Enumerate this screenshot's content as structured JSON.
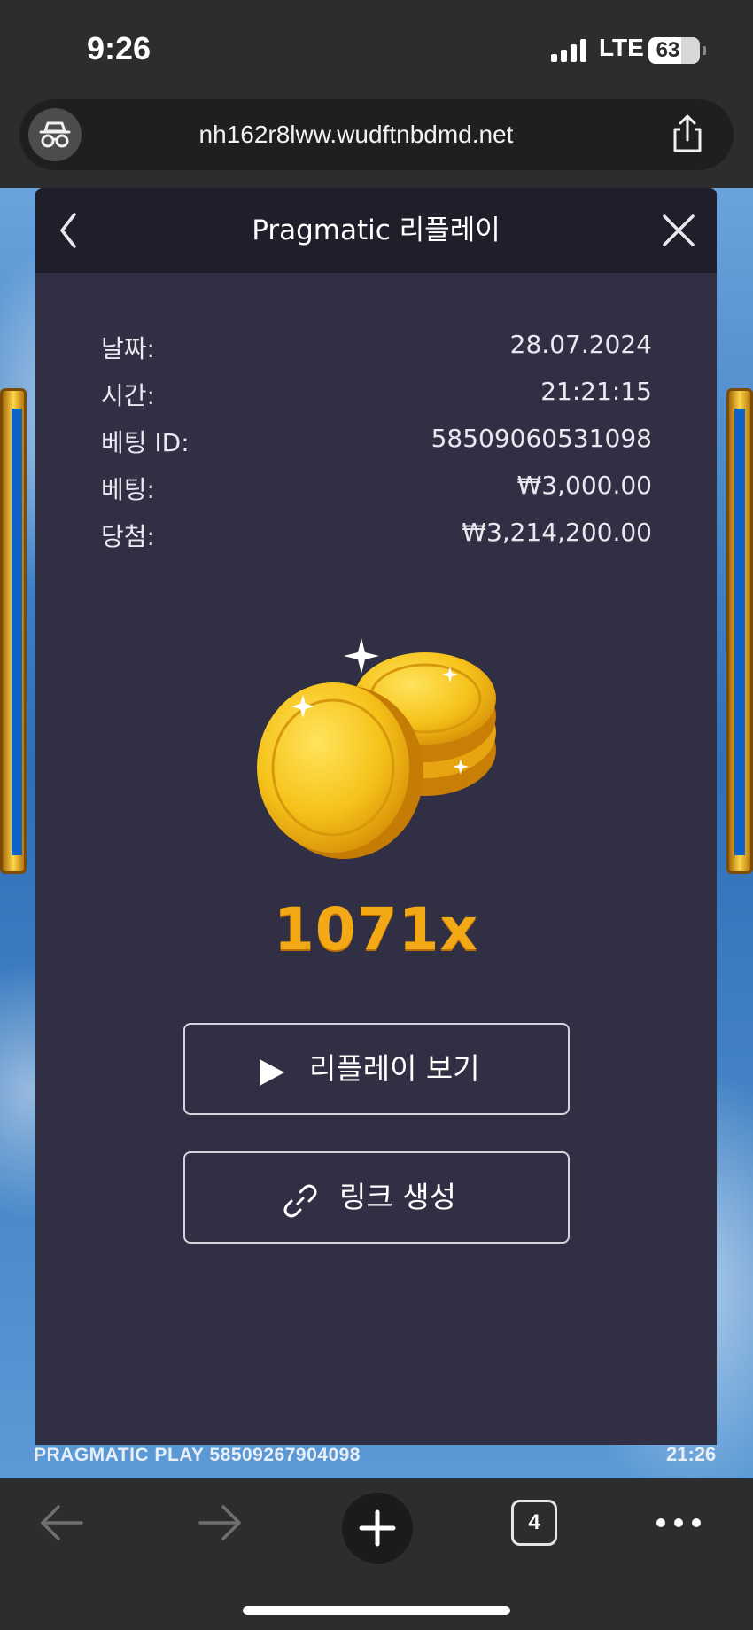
{
  "status_bar": {
    "time": "9:26",
    "network": "LTE",
    "battery": "63",
    "battery_level": 0.63
  },
  "browser": {
    "url": "nh162r8lww.wudftnbdmd.net",
    "tab_count": "4"
  },
  "game": {
    "footer_left": "PRAGMATIC PLAY  58509267904098",
    "footer_right": "21:26"
  },
  "modal": {
    "title": "Pragmatic 리플레이",
    "details": [
      {
        "label": "날짜:",
        "value": "28.07.2024"
      },
      {
        "label": "시간:",
        "value": "21:21:15"
      },
      {
        "label": "베팅 ID:",
        "value": "58509060531098"
      },
      {
        "label": "베팅:",
        "value": "₩3,000.00"
      },
      {
        "label": "당첨:",
        "value": "₩3,214,200.00"
      }
    ],
    "multiplier": "1071x",
    "replay_button": "리플레이 보기",
    "link_button": "링크 생성"
  },
  "colors": {
    "modal_bg": "#302f44",
    "header_bg": "#1f1e2b",
    "multiplier": "#f3a915",
    "browser_chrome": "#2b2d2e"
  },
  "icons": [
    "incognito-icon",
    "share-icon",
    "back-icon",
    "close-icon",
    "coins-icon",
    "play-icon",
    "link-icon",
    "arrow-left-icon",
    "arrow-right-icon",
    "plus-icon",
    "tabs-icon",
    "more-icon"
  ]
}
